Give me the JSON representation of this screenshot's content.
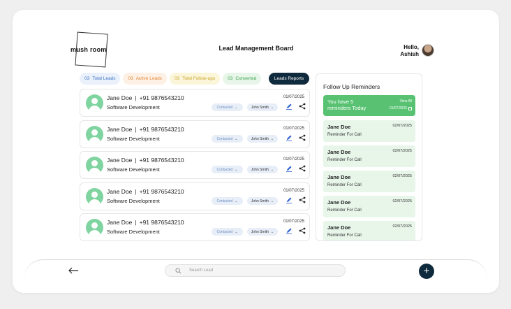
{
  "header": {
    "logo_text": "mush room",
    "title": "Lead Management Board",
    "greeting_line1": "Hello,",
    "greeting_line2": "Ashish"
  },
  "stats": [
    {
      "num": "03",
      "label": "Total Leads"
    },
    {
      "num": "03",
      "label": "Active Leads"
    },
    {
      "num": "03",
      "label": "Total Follow-ups"
    },
    {
      "num": "03",
      "label": "Converted"
    }
  ],
  "report_button": "Leads Reports",
  "leads": [
    {
      "name": "Jane Doe",
      "sep": "|",
      "phone": "+91 9876543210",
      "dept": "Software Development",
      "date": "01/07/2025",
      "status": "Contacted",
      "owner": "John Smith"
    },
    {
      "name": "Jane Doe",
      "sep": "|",
      "phone": "+91 9876543210",
      "dept": "Software Development",
      "date": "01/07/2025",
      "status": "Contacted",
      "owner": "John Smith"
    },
    {
      "name": "Jane Doe",
      "sep": "|",
      "phone": "+91 9876543210",
      "dept": "Software Development",
      "date": "01/07/2025",
      "status": "Contacted",
      "owner": "John Smith"
    },
    {
      "name": "Jane Doe",
      "sep": "|",
      "phone": "+91 9876543210",
      "dept": "Software Development",
      "date": "01/07/2025",
      "status": "Contacted",
      "owner": "John Smith"
    },
    {
      "name": "Jane Doe",
      "sep": "|",
      "phone": "+91 9876543210",
      "dept": "Software Development",
      "date": "01/07/2025",
      "status": "Contacted",
      "owner": "John Smith"
    }
  ],
  "reminders": {
    "title": "Follow Up Reminders",
    "banner_text": "You have 5 reminders Today",
    "view_all": "View All",
    "banner_date": "01/07/2025",
    "items": [
      {
        "name": "Jane Doe",
        "date": "02/07/2025",
        "text": "Reminder For Call"
      },
      {
        "name": "Jane Doe",
        "date": "02/07/2025",
        "text": "Reminder For Call"
      },
      {
        "name": "Jane Doe",
        "date": "02/07/2025",
        "text": "Reminder For Call"
      },
      {
        "name": "Jane Doe",
        "date": "02/07/2025",
        "text": "Reminder For Call"
      },
      {
        "name": "Jane Doe",
        "date": "02/07/2025",
        "text": "Reminder For Call"
      }
    ]
  },
  "bottom": {
    "search_placeholder": "Search Lead",
    "add_label": "+"
  },
  "colors": {
    "accent_dark": "#0f2a3c",
    "success_green": "#58c272",
    "reminder_bg": "#e8f6ea"
  }
}
